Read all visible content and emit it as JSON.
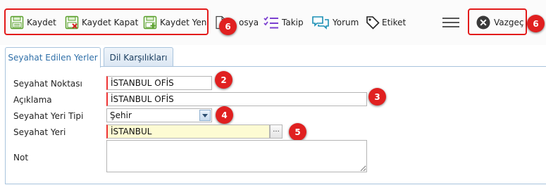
{
  "toolbar": {
    "save": "Kaydet",
    "save_close": "Kaydet Kapat",
    "save_new": "Kaydet Yeni",
    "file": "Dosya",
    "file_visible": "osya",
    "follow": "Takip",
    "comment": "Yorum",
    "tag": "Etiket",
    "cancel": "Vazgeç"
  },
  "badges": {
    "b6a": "6",
    "b2": "2",
    "b3": "3",
    "b4": "4",
    "b5": "5",
    "b6b": "6"
  },
  "tabs": [
    {
      "label": "Seyahat Edilen Yerler",
      "active": true
    },
    {
      "label": "Dil Karşılıkları",
      "active": false
    }
  ],
  "form": {
    "travel_point": {
      "label": "Seyahat Noktası",
      "value": "İSTANBUL OFİS"
    },
    "description": {
      "label": "Açıklama",
      "value": "İSTANBUL OFİS"
    },
    "place_type": {
      "label": "Seyahat Yeri Tipi",
      "value": "Şehir"
    },
    "place": {
      "label": "Seyahat Yeri",
      "value": "İSTANBUL",
      "lookup": "···"
    },
    "note": {
      "label": "Not",
      "value": ""
    }
  },
  "colors": {
    "accent_red": "#e31b1b",
    "save_green": "#5aa02c",
    "follow_purple": "#7b3fd0",
    "comment_teal": "#1b8fb5",
    "tab_active_text": "#2f6fa8"
  }
}
